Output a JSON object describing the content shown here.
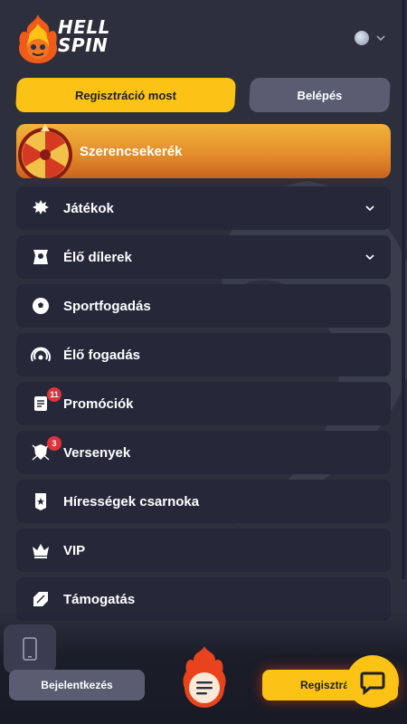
{
  "header": {
    "logo_line1": "HELL",
    "logo_line2": "SPIN",
    "logo_icon": "flame-mascot-icon",
    "language_icon": "globe-icon"
  },
  "auth": {
    "register_label": "Regisztráció most",
    "login_label": "Belépés"
  },
  "banner": {
    "label": "Szerencsekerék",
    "icon": "fortune-wheel-icon"
  },
  "menu": {
    "items": [
      {
        "label": "Játékok",
        "icon": "games-icon",
        "expandable": true
      },
      {
        "label": "Élő dílerek",
        "icon": "live-dealer-icon",
        "expandable": true
      },
      {
        "label": "Sportfogadás",
        "icon": "soccer-ball-icon"
      },
      {
        "label": "Élő fogadás",
        "icon": "live-signal-icon"
      },
      {
        "label": "Promóciók",
        "icon": "scroll-icon",
        "badge": "11"
      },
      {
        "label": "Versenyek",
        "icon": "tournament-shield-icon",
        "badge": "3"
      },
      {
        "label": "Hírességek csarnoka",
        "icon": "banner-star-icon"
      },
      {
        "label": "VIP",
        "icon": "crown-icon"
      },
      {
        "label": "Támogatás",
        "icon": "support-icon"
      }
    ]
  },
  "bottom": {
    "login_label": "Bejelentkezés",
    "register_label": "Regisztráció",
    "menu_icon": "hamburger-icon",
    "chat_icon": "chat-icon",
    "phone_icon": "phone-icon"
  },
  "colors": {
    "background": "#2d2f3d",
    "accent_yellow": "#fbc316",
    "button_gray": "#5a5d72",
    "menu_item": "#26283a",
    "badge_red": "#e0323d"
  }
}
